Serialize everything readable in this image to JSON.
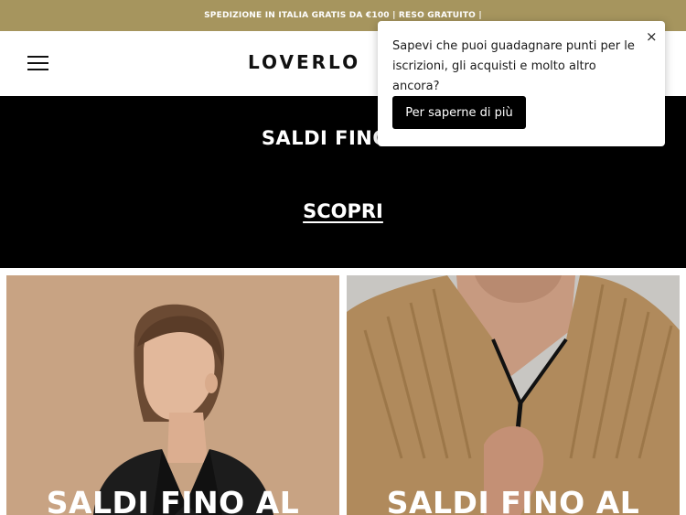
{
  "announcement": {
    "text": "SPEDIZIONE IN ITALIA GRATIS DA €100 | RESO GRATUITO |"
  },
  "header": {
    "logo": "LOVERLO",
    "menu_icon": "hamburger-menu-icon"
  },
  "hero": {
    "title": "SALDI FINO AL",
    "cta": "SCOPRI"
  },
  "tiles": [
    {
      "label": "SALDI FINO AL",
      "image": "woman-black-blazer-photo"
    },
    {
      "label": "SALDI FINO AL",
      "image": "man-camel-zip-sweater-photo"
    }
  ],
  "popup": {
    "message": "Sapevi che puoi guadagnare punti per le iscrizioni, gli acquisti e molto altro ancora?",
    "button": "Per saperne di più",
    "close": "×"
  },
  "colors": {
    "announcement_bg": "#a6955e",
    "hero_bg": "#000000",
    "tile_left_bg": "#c8a383",
    "tile_right_bg": "#c8c6c2"
  }
}
